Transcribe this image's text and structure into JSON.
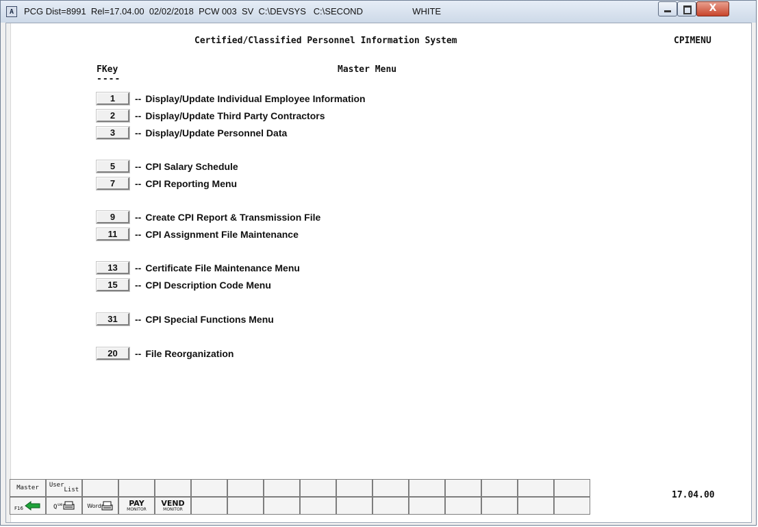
{
  "window": {
    "title": "PCG Dist=8991  Rel=17.04.00  02/02/2018  PCW 003  SV  C:\\DEVSYS   C:\\SECOND                    WHITE",
    "app_icon": "A",
    "close_glyph": "X"
  },
  "screen": {
    "system_title": "Certified/Classified Personnel Information System",
    "screen_id": "CPIMENU",
    "fkey_header": "FKey",
    "fkey_underline": "----",
    "menu_header": "Master Menu",
    "version": "17.04.00"
  },
  "menu": [
    {
      "key": "1",
      "label": "Display/Update Individual Employee Information"
    },
    {
      "key": "2",
      "label": "Display/Update Third Party Contractors"
    },
    {
      "key": "3",
      "label": "Display/Update Personnel Data"
    },
    {
      "key": "5",
      "label": "CPI Salary Schedule"
    },
    {
      "key": "7",
      "label": "CPI Reporting Menu"
    },
    {
      "key": "9",
      "label": "Create CPI Report & Transmission File"
    },
    {
      "key": "11",
      "label": "CPI Assignment File Maintenance"
    },
    {
      "key": "13",
      "label": "Certificate File Maintenance Menu"
    },
    {
      "key": "15",
      "label": "CPI Description Code Menu"
    },
    {
      "key": "31",
      "label": "CPI Special Functions Menu"
    },
    {
      "key": "20",
      "label": "File Reorganization"
    }
  ],
  "menu_separator": "--",
  "toolbar": {
    "master": "Master",
    "user_list_a": "User",
    "user_list_b": "List",
    "f16": "F16",
    "word": "Word",
    "pay": "PAY",
    "pay_sub": "MONITOR",
    "vend": "VEND",
    "vend_sub": "MONITOR",
    "back_icon": "back-arrow-icon",
    "queue_icon": "queue-printer-icon",
    "word_icon": "word-printer-icon"
  },
  "colors": {
    "close_button": "#c8452c",
    "back_arrow": "#1fa33a"
  }
}
